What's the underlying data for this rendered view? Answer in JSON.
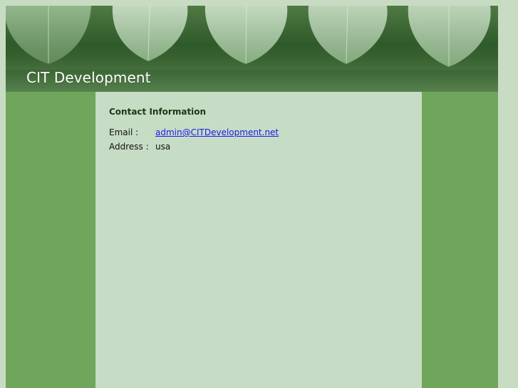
{
  "site": {
    "title": "CIT Development"
  },
  "contact": {
    "heading": "Contact Information",
    "email_label": "Email :",
    "email_value": "admin@CITDevelopment.net",
    "address_label": "Address :",
    "address_value": "usa"
  },
  "colors": {
    "outer_background": "#c8dcc4",
    "side_panels": "#6fa65b",
    "content_background": "#c7dcc5",
    "heading_text": "#173b14",
    "link": "#1a1aee"
  }
}
